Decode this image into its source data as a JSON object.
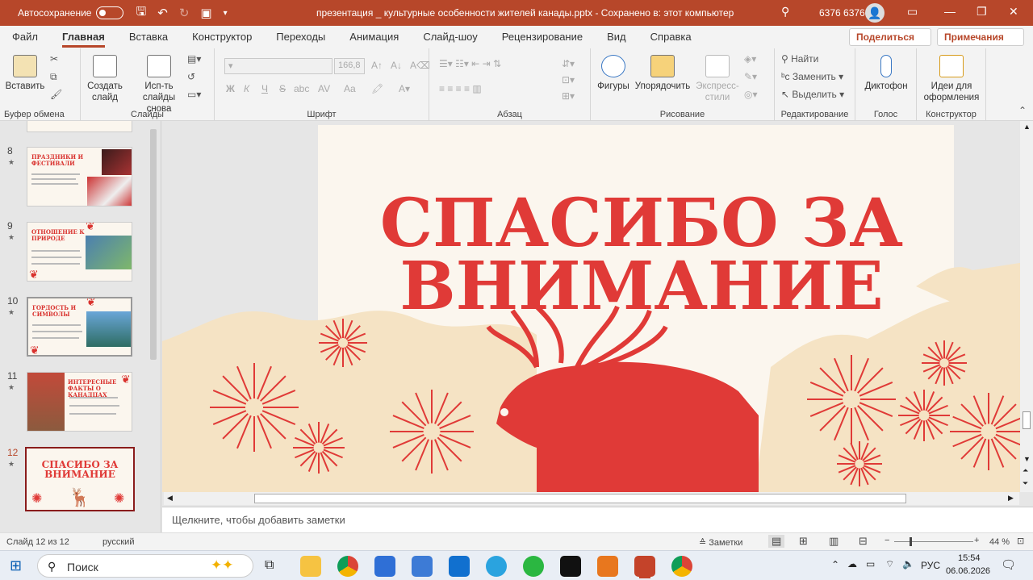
{
  "titlebar": {
    "autosave_label": "Автосохранение",
    "doc_title": "презентация _ культурные особенности жителей канады.pptx  -  Сохранено в: этот компьютер",
    "user": "6376 6376"
  },
  "tabs": [
    "Файл",
    "Главная",
    "Вставка",
    "Конструктор",
    "Переходы",
    "Анимация",
    "Слайд-шоу",
    "Рецензирование",
    "Вид",
    "Справка"
  ],
  "share_button": "Поделиться",
  "comments_button": "Примечания",
  "ribbon": {
    "clipboard": {
      "paste": "Вставить",
      "label": "Буфер обмена"
    },
    "slides": {
      "new_slide": "Создать слайд",
      "reuse": "Исп-ть слайды снова",
      "label": "Слайды"
    },
    "font": {
      "font_size": "166,8",
      "bold": "Ж",
      "italic": "К",
      "underline": "Ч",
      "strike": "S",
      "abc": "abc",
      "spacing": "AV",
      "case": "Aa",
      "label": "Шрифт"
    },
    "paragraph": {
      "label": "Абзац"
    },
    "drawing": {
      "shapes": "Фигуры",
      "arrange": "Упорядочить",
      "quick_styles": "Экспресс-стили",
      "label": "Рисование"
    },
    "editing": {
      "find": "Найти",
      "replace": "Заменить",
      "select": "Выделить",
      "label": "Редактирование"
    },
    "voice": {
      "dictate": "Диктофон",
      "label": "Голос"
    },
    "designer": {
      "ideas": "Идеи для оформления",
      "label": "Конструктор"
    }
  },
  "thumbnails": [
    {
      "num": "8",
      "title": "ПРАЗДНИКИ И ФЕСТИВАЛИ"
    },
    {
      "num": "9",
      "title": "ОТНОШЕНИЕ К ПРИРОДЕ"
    },
    {
      "num": "10",
      "title": "ГОРДОСТЬ И СИМВОЛЫ"
    },
    {
      "num": "11",
      "title": "ИНТЕРЕСНЫЕ ФАКТЫ О КАНАДЦАХ"
    },
    {
      "num": "12",
      "title": "СПАСИБО ЗА ВНИМАНИЕ"
    }
  ],
  "slide": {
    "line1": "СПАСИБО ЗА",
    "line2": "ВНИМАНИЕ",
    "accent": "#e03a37",
    "bg": "#fbf6ee",
    "map": "#f5e3c4"
  },
  "notes_placeholder": "Щелкните, чтобы добавить заметки",
  "status": {
    "slide": "Слайд 12 из 12",
    "lang": "русский",
    "notes": "Заметки",
    "zoom": "44 %"
  },
  "taskbar": {
    "search": "Поиск",
    "lang": "РУС",
    "time": "15:54",
    "date": "06.06.2026"
  }
}
